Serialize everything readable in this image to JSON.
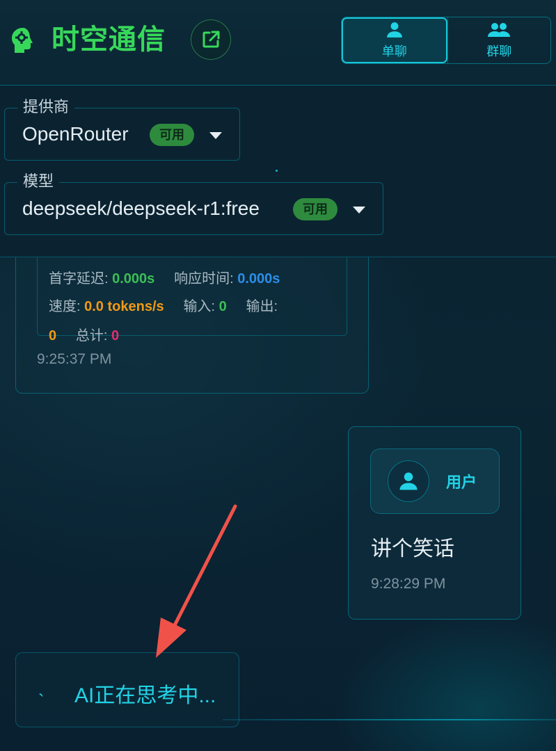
{
  "header": {
    "title": "时空通信",
    "brand_icon": "brain-head-icon",
    "open_icon": "external-link-icon",
    "tabs": [
      {
        "label": "单聊",
        "icon": "person-icon",
        "active": true
      },
      {
        "label": "群聊",
        "icon": "group-icon",
        "active": false
      }
    ]
  },
  "selectors": {
    "provider": {
      "label": "提供商",
      "value": "OpenRouter",
      "badge": "可用"
    },
    "model": {
      "label": "模型",
      "value": "deepseek/deepseek-r1:free",
      "badge": "可用"
    }
  },
  "ai_message": {
    "stats": {
      "first_token_label": "首字延迟:",
      "first_token_value": "0.000s",
      "response_label": "响应时间:",
      "response_value": "0.000s",
      "speed_label": "速度:",
      "speed_value": "0.0 tokens/s",
      "input_label": "输入:",
      "input_value": "0",
      "output_label": "输出:",
      "output_value": "0",
      "total_label": "总计:",
      "total_value": "0"
    },
    "timestamp": "9:25:37 PM"
  },
  "user_message": {
    "sender": "用户",
    "text": "讲个笑话",
    "timestamp": "9:28:29 PM"
  },
  "thinking": {
    "text": "AI正在思考中..."
  },
  "colors": {
    "accent_cyan": "#22d3e6",
    "brand_green": "#37d85a",
    "badge_green": "#2e8b3e",
    "arrow_red": "#f0524a"
  }
}
